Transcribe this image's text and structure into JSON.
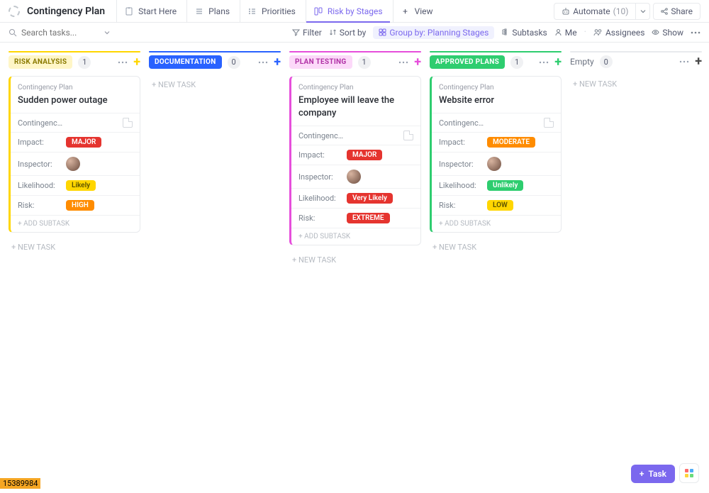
{
  "header": {
    "title": "Contingency Plan",
    "tabs": [
      {
        "label": "Start Here"
      },
      {
        "label": "Plans"
      },
      {
        "label": "Priorities"
      },
      {
        "label": "Risk by Stages",
        "active": true
      },
      {
        "label": "View",
        "isAdd": true
      }
    ],
    "automate": {
      "label": "Automate",
      "count": "(10)"
    },
    "share": "Share"
  },
  "toolbar": {
    "search_placeholder": "Search tasks...",
    "filter": "Filter",
    "sort": "Sort by",
    "group": "Group by: Planning Stages",
    "subtasks": "Subtasks",
    "me": "Me",
    "assignees": "Assignees",
    "show": "Show"
  },
  "columns": [
    {
      "name": "RISK ANALYSIS",
      "count": "1",
      "bar": "#ffd600",
      "labelBg": "#fff6c7",
      "labelColor": "#8a7a00",
      "plus": "#ffd600",
      "cards": [
        {
          "list": "Contingency Plan",
          "title": "Sudden power outage",
          "side": "#ffd600",
          "fieldDoc": "Contingenc…",
          "impact": {
            "text": "MAJOR",
            "bg": "#e5342f"
          },
          "likelihood": {
            "text": "Likely",
            "bg": "#ffd600",
            "color": "#5b5200"
          },
          "risk": {
            "text": "HIGH",
            "bg": "#ff8c00"
          }
        }
      ]
    },
    {
      "name": "DOCUMENTATION",
      "count": "0",
      "bar": "#2962ff",
      "labelBg": "#2962ff",
      "labelColor": "#ffffff",
      "plus": "#2962ff",
      "cards": []
    },
    {
      "name": "PLAN TESTING",
      "count": "1",
      "bar": "#e64edb",
      "labelBg": "#fcd9f9",
      "labelColor": "#b030a5",
      "plus": "#e64edb",
      "cards": [
        {
          "list": "Contingency Plan",
          "title": "Employee will leave the company",
          "side": "#e64edb",
          "fieldDoc": "Contingenc…",
          "impact": {
            "text": "MAJOR",
            "bg": "#e5342f"
          },
          "likelihood": {
            "text": "Very Likely",
            "bg": "#e5342f"
          },
          "risk": {
            "text": "EXTREME",
            "bg": "#e5342f"
          }
        }
      ]
    },
    {
      "name": "APPROVED PLANS",
      "count": "1",
      "bar": "#2ecd6f",
      "labelBg": "#2ecd6f",
      "labelColor": "#ffffff",
      "plus": "#2ecd6f",
      "cards": [
        {
          "list": "Contingency Plan",
          "title": "Website error",
          "side": "#2ecd6f",
          "fieldDoc": "Contingenc…",
          "impact": {
            "text": "MODERATE",
            "bg": "#ff8c00"
          },
          "likelihood": {
            "text": "Unlikely",
            "bg": "#2ecd6f"
          },
          "risk": {
            "text": "LOW",
            "bg": "#ffd600",
            "color": "#5b5200"
          }
        }
      ]
    },
    {
      "name": "Empty",
      "count": "0",
      "bar": "#e8eaed",
      "isEmpty": true,
      "cards": []
    }
  ],
  "strings": {
    "new_task": "+ NEW TASK",
    "add_subtask": "+ ADD SUBTASK",
    "impact": "Impact:",
    "inspector": "Inspector:",
    "likelihood": "Likelihood:",
    "risk": "Risk:",
    "task_btn": "Task"
  },
  "footer_id": "15389984"
}
